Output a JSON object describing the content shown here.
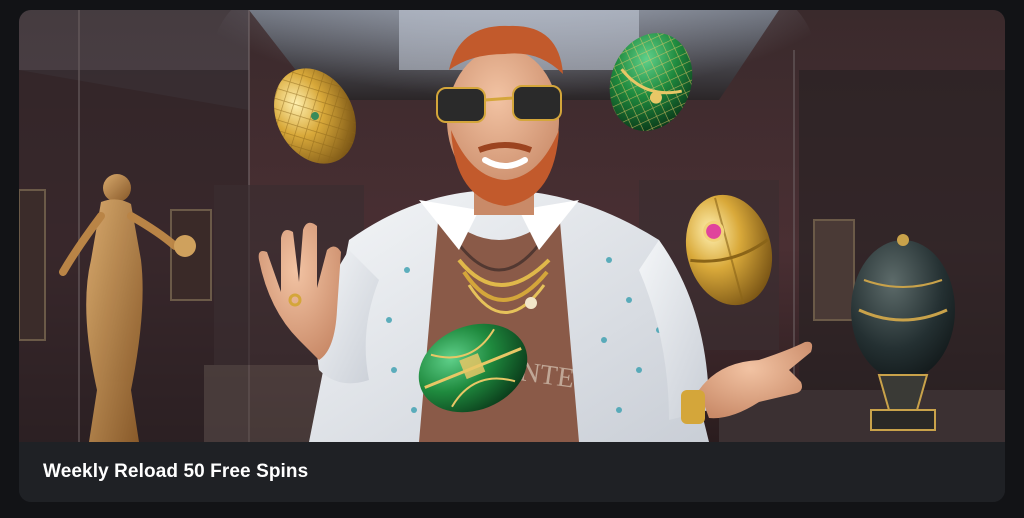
{
  "promo": {
    "title": "Weekly Reload 50 Free Spins",
    "image_description": "illustration-man-in-sunglasses-juggling-jeweled-eggs-in-museum"
  },
  "colors": {
    "page_background": "#121316",
    "caption_background": "#1f2125",
    "caption_text": "#ffffff",
    "egg_gold": "#d4a63a",
    "egg_green": "#1f8a3e",
    "shirt": "#e9ecef",
    "beard": "#c25a2c"
  }
}
